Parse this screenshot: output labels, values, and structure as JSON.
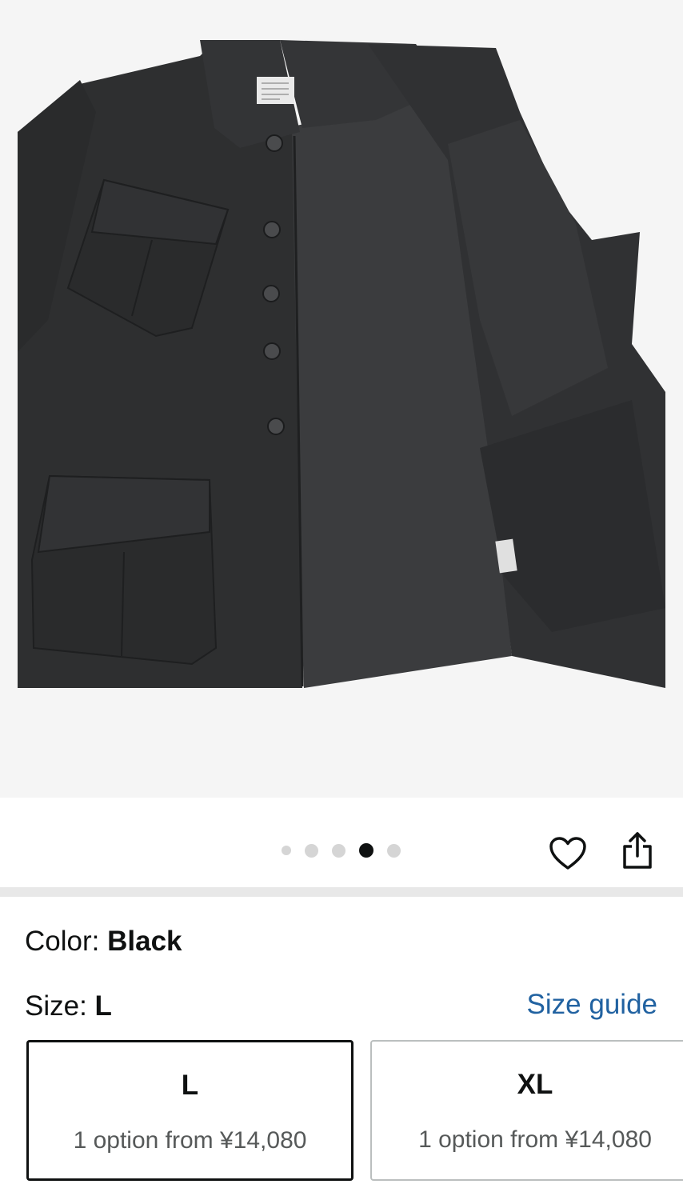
{
  "product_image": {
    "alt_icon": "product-photo-jacket",
    "colors": {
      "background": "#f5f5f5",
      "fabric": "#2e2f30",
      "lining": "#3b3c3e"
    }
  },
  "carousel": {
    "dots": [
      {
        "state": "inactive"
      },
      {
        "state": "inactive"
      },
      {
        "state": "inactive"
      },
      {
        "state": "active"
      },
      {
        "state": "inactive"
      }
    ],
    "active_index": 3,
    "wishlist_icon": "heart-icon",
    "share_icon": "share-icon"
  },
  "variation": {
    "color_label": "Color:",
    "color_value": "Black",
    "size_label": "Size:",
    "size_value": "L",
    "size_guide_label": "Size guide",
    "sizes": [
      {
        "name": "L",
        "price_text": "1 option from ¥14,080",
        "selected": true
      },
      {
        "name": "XL",
        "price_text": "1 option from ¥14,080",
        "selected": false
      }
    ]
  },
  "colors": {
    "link": "#2162a1",
    "text": "#0f1111",
    "muted": "#565959",
    "divider": "#e8e8e8"
  }
}
